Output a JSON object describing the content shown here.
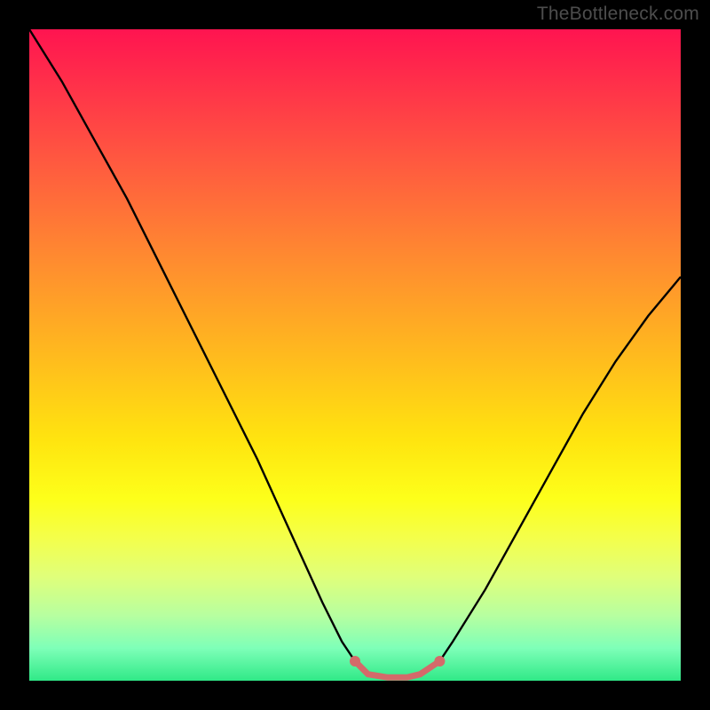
{
  "watermark": "TheBottleneck.com",
  "chart_data": {
    "type": "line",
    "title": "",
    "xlabel": "",
    "ylabel": "",
    "xlim": [
      0,
      100
    ],
    "ylim": [
      0,
      100
    ],
    "grid": false,
    "gradient_stops": [
      {
        "pct": 0,
        "color": "#ff1450"
      },
      {
        "pct": 8,
        "color": "#ff2f4a"
      },
      {
        "pct": 20,
        "color": "#ff5840"
      },
      {
        "pct": 35,
        "color": "#ff8a30"
      },
      {
        "pct": 50,
        "color": "#ffba1e"
      },
      {
        "pct": 63,
        "color": "#ffe40f"
      },
      {
        "pct": 72,
        "color": "#fdff1a"
      },
      {
        "pct": 78,
        "color": "#f4ff4a"
      },
      {
        "pct": 84,
        "color": "#e0ff7a"
      },
      {
        "pct": 90,
        "color": "#b7ffa0"
      },
      {
        "pct": 95,
        "color": "#7effb8"
      },
      {
        "pct": 100,
        "color": "#30e987"
      }
    ],
    "series": [
      {
        "name": "bottleneck-curve",
        "color": "#000000",
        "x": [
          0,
          5,
          10,
          15,
          20,
          25,
          30,
          35,
          40,
          45,
          48,
          50,
          52,
          55,
          58,
          60,
          63,
          65,
          70,
          75,
          80,
          85,
          90,
          95,
          100
        ],
        "y": [
          100,
          92,
          83,
          74,
          64,
          54,
          44,
          34,
          23,
          12,
          6,
          3,
          1,
          0.5,
          0.5,
          1,
          3,
          6,
          14,
          23,
          32,
          41,
          49,
          56,
          62
        ]
      },
      {
        "name": "optimal-zone",
        "color": "#d46a6a",
        "x": [
          50,
          52,
          55,
          58,
          60,
          63
        ],
        "y": [
          3,
          1,
          0.5,
          0.5,
          1,
          3
        ]
      }
    ],
    "optimal_zone_endpoints": {
      "left": {
        "x": 50,
        "y": 3
      },
      "right": {
        "x": 63,
        "y": 3
      }
    }
  }
}
